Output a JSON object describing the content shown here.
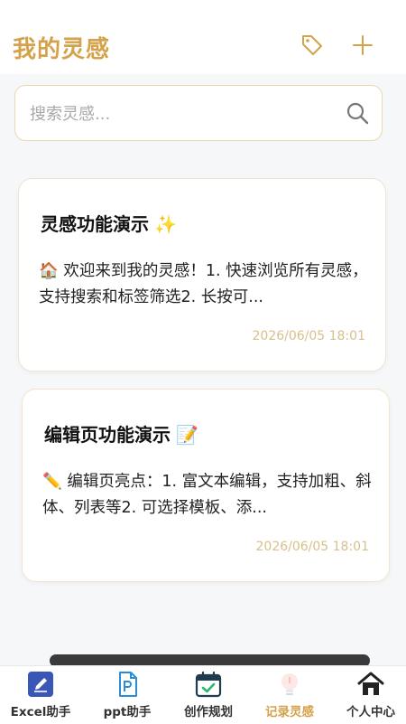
{
  "header": {
    "title": "我的灵感"
  },
  "search": {
    "placeholder": "搜索灵感..."
  },
  "cards": [
    {
      "title": "灵感功能演示",
      "emoji": "✨",
      "body": "🏠 欢迎来到我的灵感！1. 快速浏览所有灵感，支持搜索和标签筛选2. 长按可...",
      "time": "2026/06/05 18:01"
    },
    {
      "title": "编辑页功能演示",
      "emoji": "📝",
      "body": "✏️ 编辑页亮点：1. 富文本编辑，支持加粗、斜体、列表等2. 可选择模板、添...",
      "time": "2026/06/05 18:01"
    }
  ],
  "tabs": [
    {
      "label": "Excel助手",
      "icon": "pencil-icon",
      "active": false
    },
    {
      "label": "ppt助手",
      "icon": "ppt-icon",
      "active": false
    },
    {
      "label": "创作规划",
      "icon": "calendar-check-icon",
      "active": false
    },
    {
      "label": "记录灵感",
      "icon": "lightbulb-icon",
      "active": true
    },
    {
      "label": "个人中心",
      "icon": "home-icon",
      "active": false
    }
  ],
  "colors": {
    "accent": "#d4a24a",
    "time_text": "#d9bf8a",
    "search_border": "#ead9b0",
    "card_border": "#f1e6cc",
    "background": "#f6f7f9"
  }
}
